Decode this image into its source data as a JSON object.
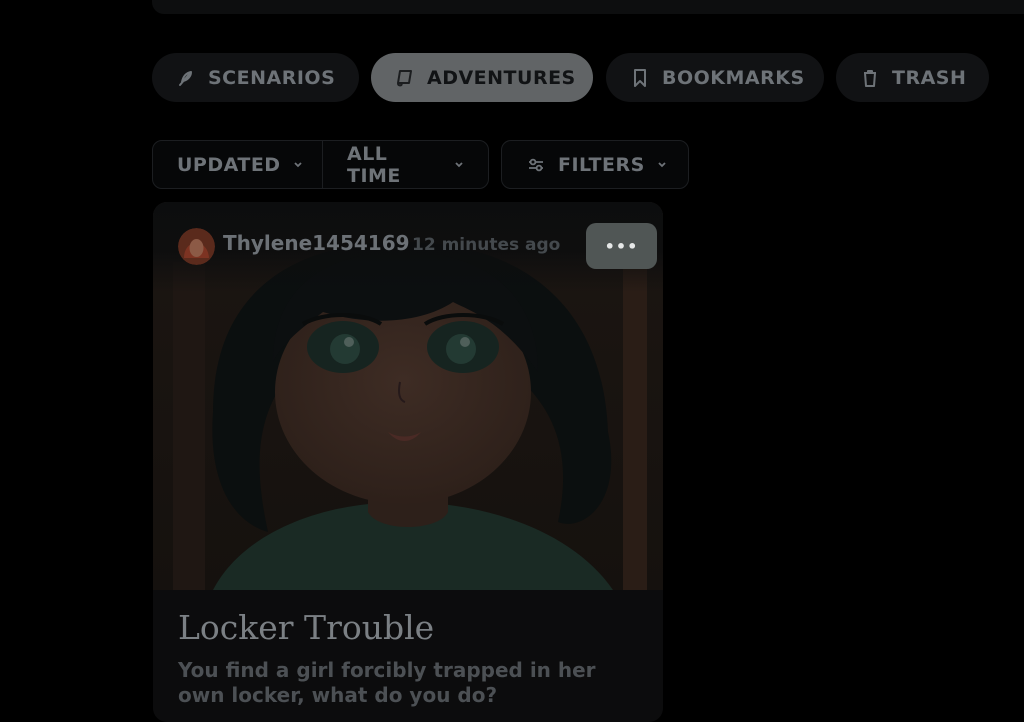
{
  "tabs": [
    {
      "label": "SCENARIOS",
      "icon": "feather-icon",
      "active": false
    },
    {
      "label": "ADVENTURES",
      "icon": "scroll-icon",
      "active": true
    },
    {
      "label": "BOOKMARKS",
      "icon": "bookmark-icon",
      "active": false
    },
    {
      "label": "TRASH",
      "icon": "trash-icon",
      "active": false
    }
  ],
  "filters": {
    "sort_label": "UPDATED",
    "time_label": "ALL TIME",
    "filters_label": "FILTERS"
  },
  "card": {
    "username": "Thylene1454169",
    "time_ago": "12 minutes ago",
    "more_label": "•••",
    "title": "Locker Trouble",
    "description": "You find a girl forcibly trapped in her own locker, what do you do?"
  },
  "colors": {
    "background": "#000000",
    "active_tab": "#616466",
    "inactive_tab": "#111214",
    "more_button": "#505655"
  }
}
